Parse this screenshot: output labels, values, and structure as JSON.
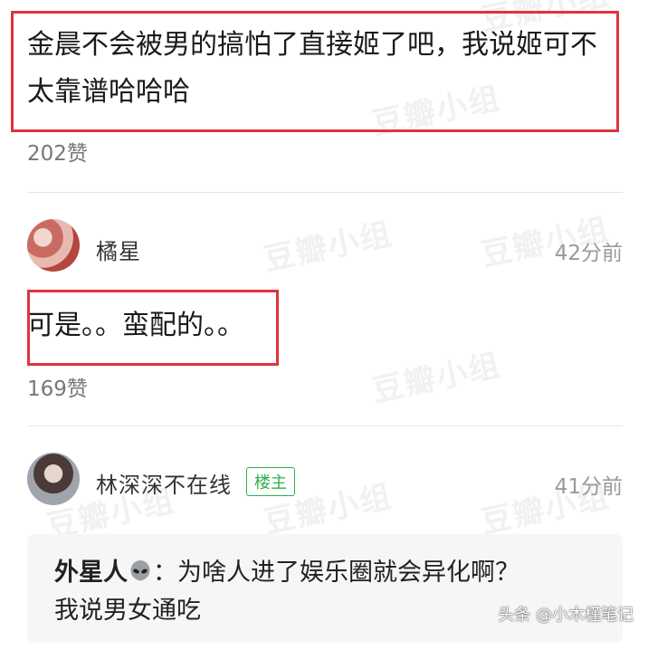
{
  "watermark": "豆瓣小组",
  "comments": [
    {
      "text": "金晨不会被男的搞怕了直接姬了吧，我说姬可不太靠谱哈哈哈",
      "likes": "202赞"
    },
    {
      "username": "橘星",
      "time": "42分前",
      "text": "可是。。蛮配的。。",
      "likes": "169赞"
    },
    {
      "username": "林深深不在线",
      "badge": "楼主",
      "time": "41分前",
      "quote": {
        "author": "外星人",
        "icon": "alien-icon",
        "separator": "：",
        "text": "为啥人进了娱乐圈就会异化啊？",
        "reply": "我说男女通吃"
      }
    }
  ],
  "footer": "头条 @小木槿笔记",
  "colors": {
    "highlight": "#e0343f",
    "badge": "#2bb04a"
  }
}
